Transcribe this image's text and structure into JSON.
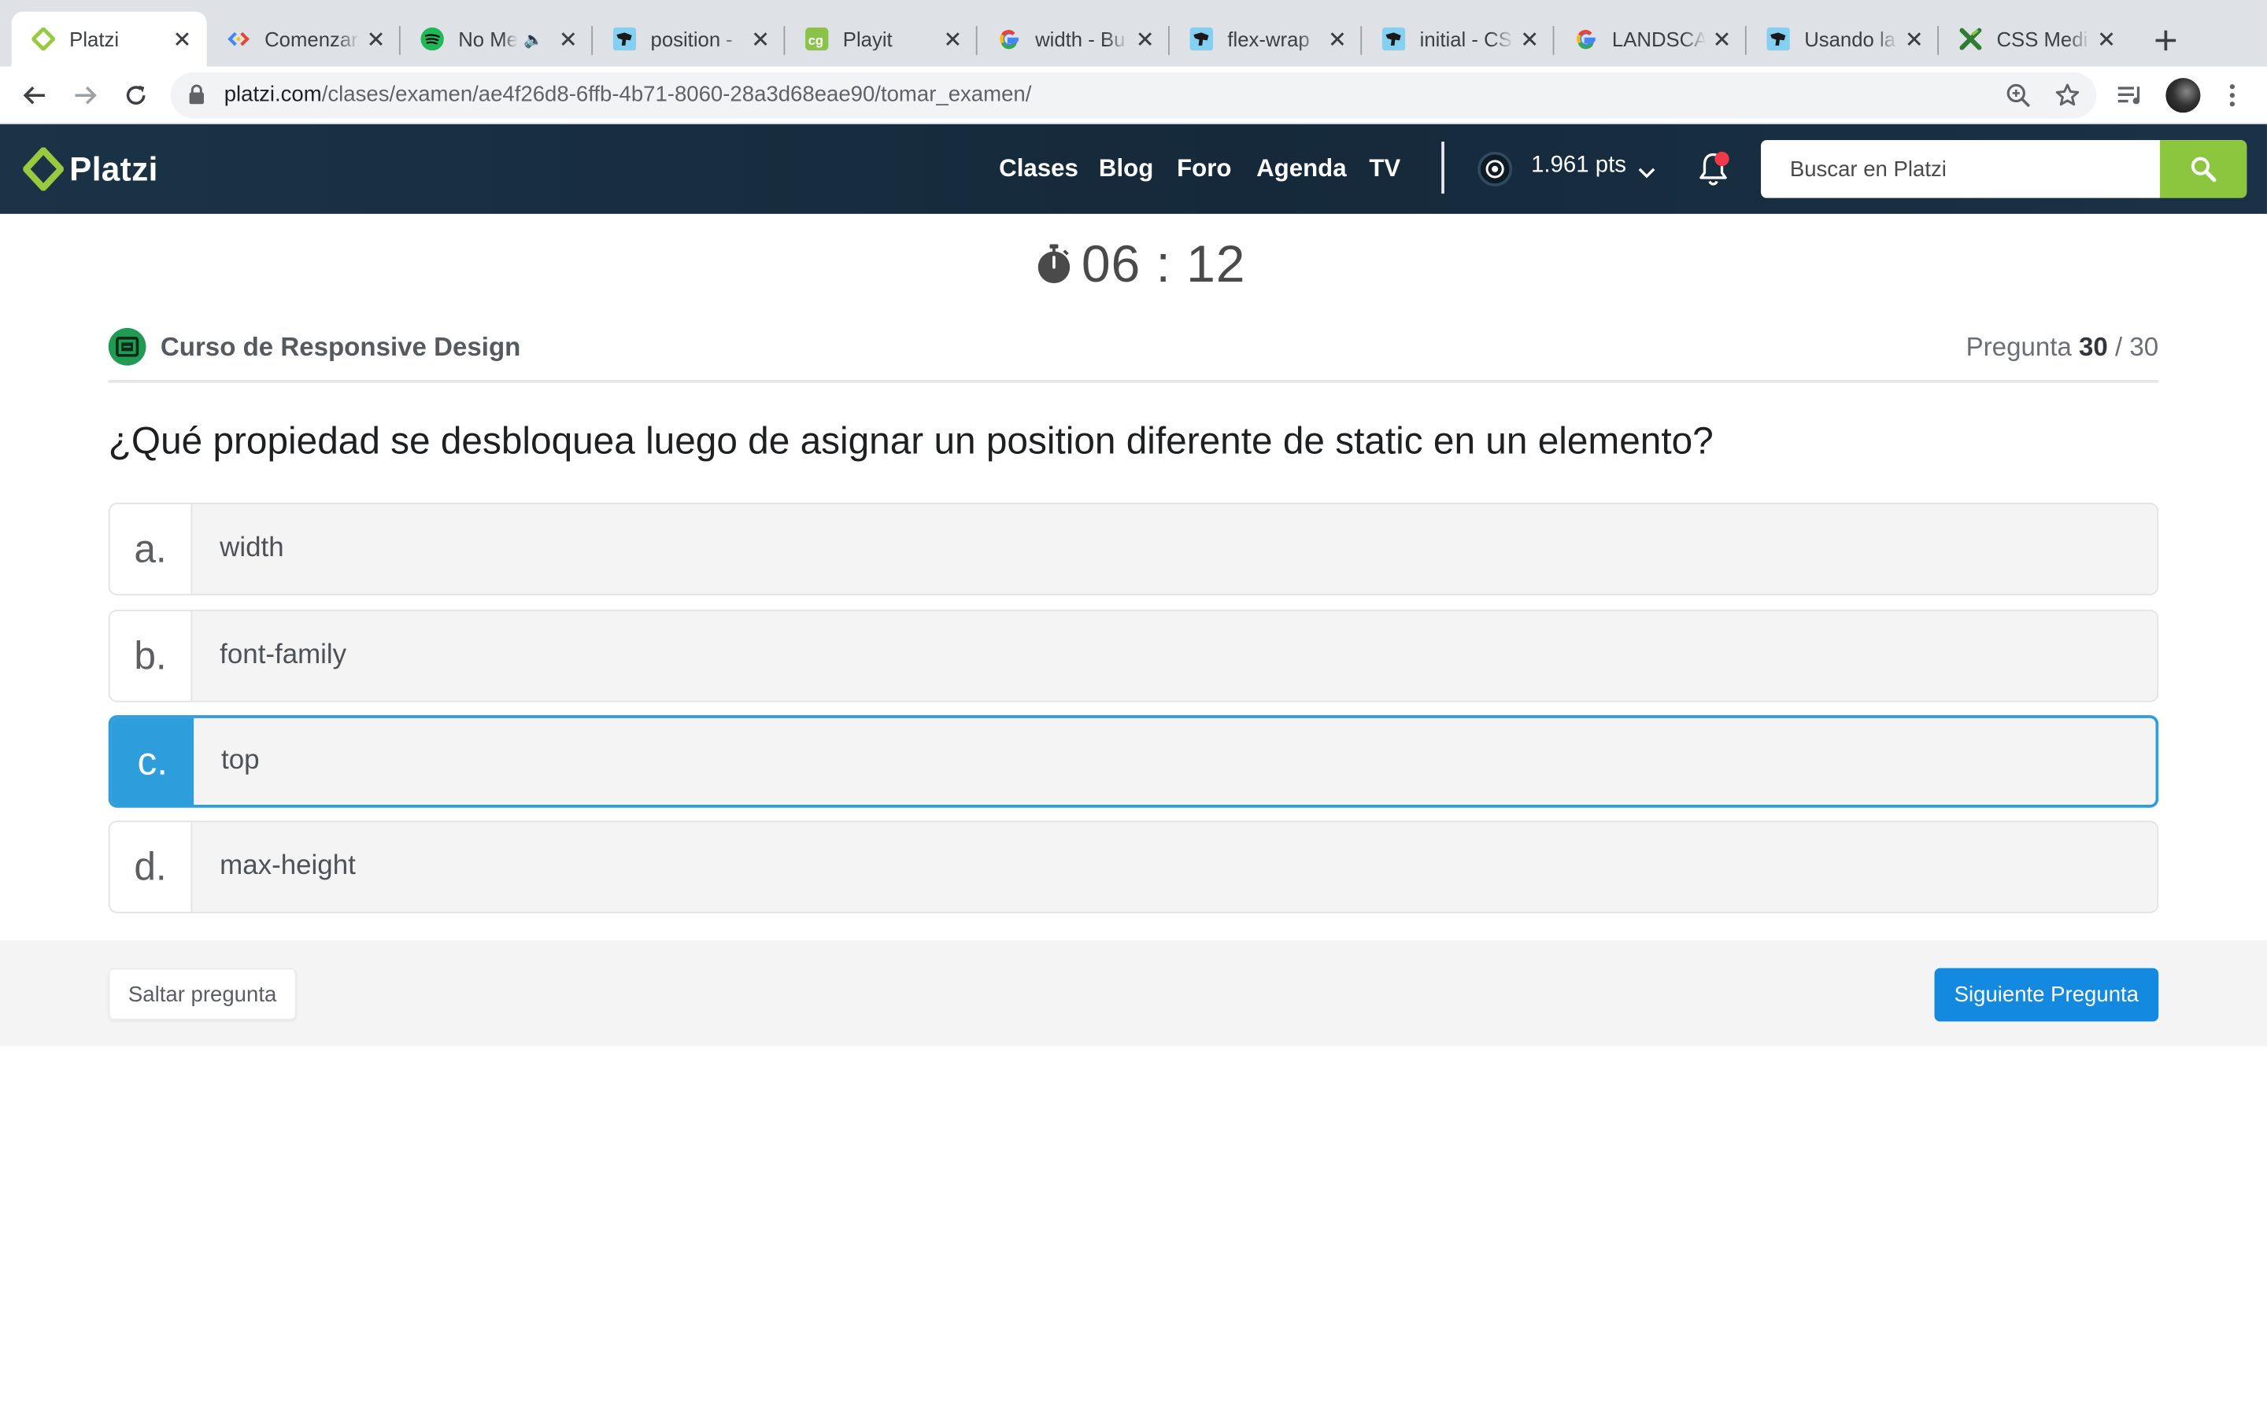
{
  "browser": {
    "tabs": [
      {
        "title": "Platzi",
        "favicon": "platzi-logo-icon",
        "active": true
      },
      {
        "title": "Comenzar",
        "favicon": "chrome-devtools-icon"
      },
      {
        "title": "No Me",
        "favicon": "spotify-icon",
        "audio": true
      },
      {
        "title": "position -",
        "favicon": "mdn-dino-icon"
      },
      {
        "title": "Playit",
        "favicon": "playit-icon"
      },
      {
        "title": "width - Bu",
        "favicon": "google-icon"
      },
      {
        "title": "flex-wrap",
        "favicon": "mdn-dino-icon"
      },
      {
        "title": "initial - CS",
        "favicon": "mdn-dino-icon"
      },
      {
        "title": "LANDSCA",
        "favicon": "google-icon"
      },
      {
        "title": "Usando la",
        "favicon": "mdn-dino-icon"
      },
      {
        "title": "CSS Medi",
        "favicon": "xataka-icon"
      }
    ],
    "url_host": "platzi.com",
    "url_path": "/clases/examen/ae4f26d8-6ffb-4b71-8060-28a3d68eae90/tomar_examen/"
  },
  "header": {
    "logo_text": "Platzi",
    "nav": [
      "Clases",
      "Blog",
      "Foro",
      "Agenda",
      "TV"
    ],
    "points": "1.961 pts",
    "search_placeholder": "Buscar en Platzi"
  },
  "exam": {
    "timer": "06 : 12",
    "course": "Curso de Responsive Design",
    "progress_label": "Pregunta",
    "progress_current": "30",
    "progress_total": "/ 30",
    "question": "¿Qué propiedad se desbloquea luego de asignar un position diferente de static en un elemento?",
    "options": [
      {
        "letter": "a.",
        "text": "width",
        "selected": false
      },
      {
        "letter": "b.",
        "text": "font-family",
        "selected": false
      },
      {
        "letter": "c.",
        "text": "top",
        "selected": true
      },
      {
        "letter": "d.",
        "text": "max-height",
        "selected": false
      }
    ],
    "skip_label": "Saltar pregunta",
    "next_label": "Siguiente Pregunta"
  },
  "colors": {
    "header_bg": "#15293a",
    "platzi_green": "#98ca3f",
    "selected_blue": "#2d9ddc",
    "next_button_blue": "#1389e0"
  }
}
